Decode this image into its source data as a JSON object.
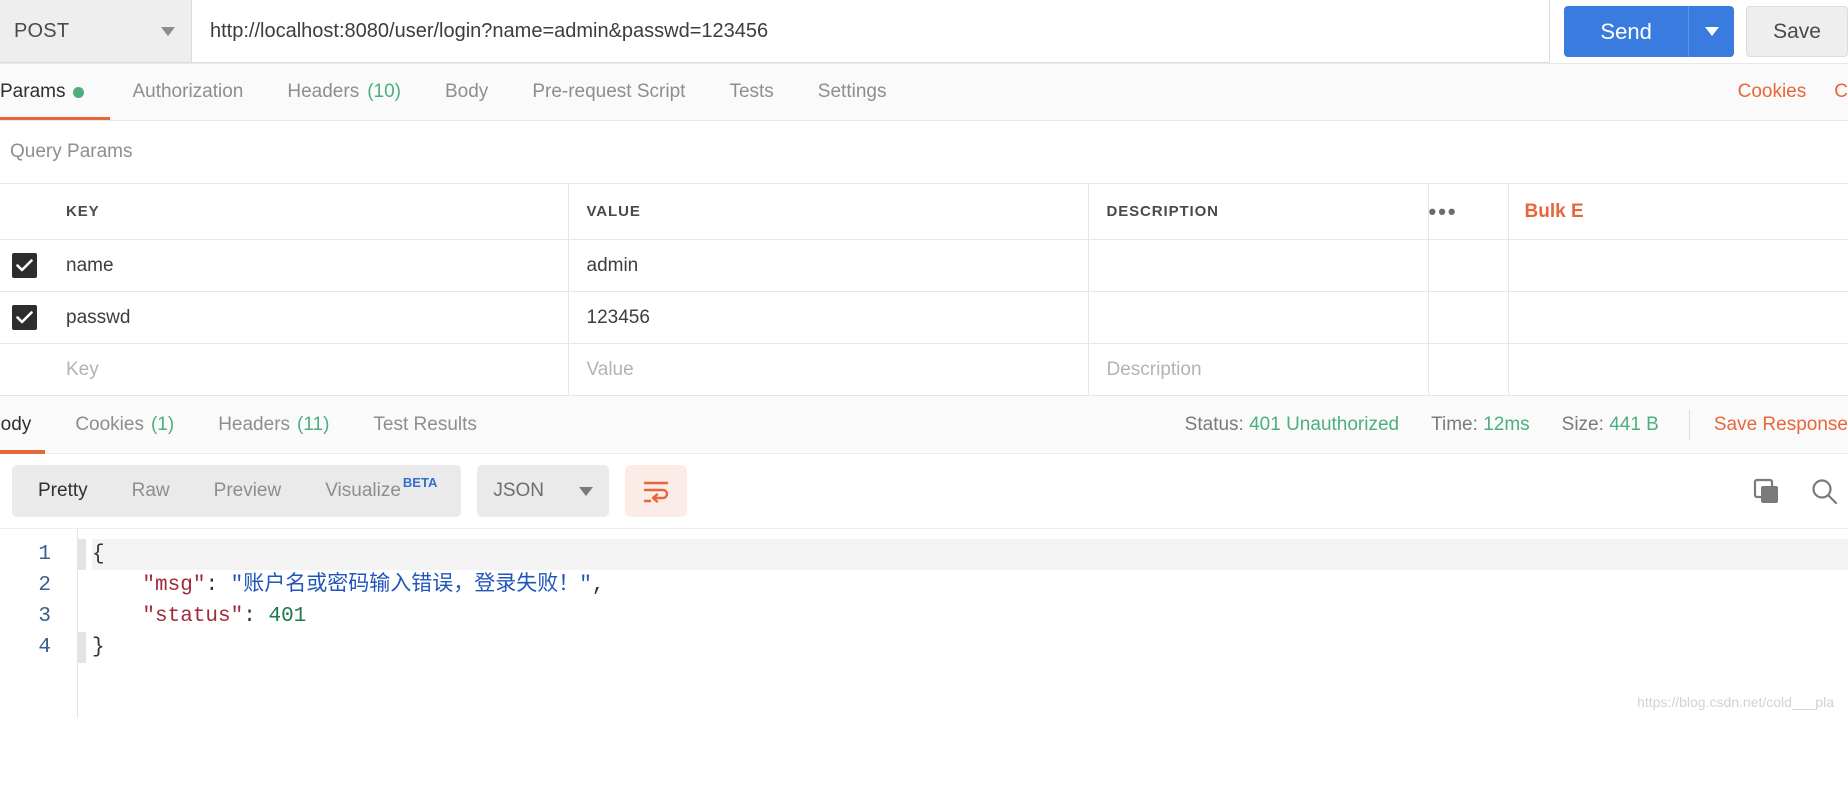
{
  "request_bar": {
    "method": "POST",
    "url": "http://localhost:8080/user/login?name=admin&passwd=123456",
    "send_label": "Send",
    "save_label": "Save"
  },
  "request_tabs": [
    {
      "label": "Params",
      "badge": "",
      "dot": true,
      "active": true
    },
    {
      "label": "Authorization",
      "badge": "",
      "dot": false,
      "active": false
    },
    {
      "label": "Headers",
      "badge": "(10)",
      "dot": false,
      "active": false
    },
    {
      "label": "Body",
      "badge": "",
      "dot": false,
      "active": false
    },
    {
      "label": "Pre-request Script",
      "badge": "",
      "dot": false,
      "active": false
    },
    {
      "label": "Tests",
      "badge": "",
      "dot": false,
      "active": false
    },
    {
      "label": "Settings",
      "badge": "",
      "dot": false,
      "active": false
    }
  ],
  "request_tabs_right": {
    "cookies": "Cookies",
    "code": "C"
  },
  "query_params": {
    "title": "Query Params",
    "columns": [
      "KEY",
      "VALUE",
      "DESCRIPTION"
    ],
    "more_options": "•••",
    "bulk_edit": "Bulk E",
    "rows": [
      {
        "checked": true,
        "key": "name",
        "value": "admin",
        "description": ""
      },
      {
        "checked": true,
        "key": "passwd",
        "value": "123456",
        "description": ""
      }
    ],
    "placeholder_row": {
      "key": "Key",
      "value": "Value",
      "description": "Description"
    }
  },
  "response_status": {
    "status_label": "Status:",
    "status_value": "401 Unauthorized",
    "time_label": "Time:",
    "time_value": "12ms",
    "size_label": "Size:",
    "size_value": "441 B",
    "save_response": "Save Response"
  },
  "response_tabs": [
    {
      "label": "Body",
      "badge": "",
      "active": true
    },
    {
      "label": "Cookies",
      "badge": "(1)",
      "active": false
    },
    {
      "label": "Headers",
      "badge": "(11)",
      "active": false
    },
    {
      "label": "Test Results",
      "badge": "",
      "active": false
    }
  ],
  "format_bar": {
    "segments": [
      "Pretty",
      "Raw",
      "Preview",
      "Visualize"
    ],
    "active_segment": "Pretty",
    "beta_badge": "BETA",
    "language": "JSON"
  },
  "code_body": {
    "line_numbers": [
      "1",
      "2",
      "3",
      "4"
    ],
    "lines": [
      {
        "indent": "",
        "tokens": [
          {
            "t": "brace",
            "v": "{"
          }
        ]
      },
      {
        "indent": "    ",
        "tokens": [
          {
            "t": "key",
            "v": "\"msg\""
          },
          {
            "t": "punct",
            "v": ": "
          },
          {
            "t": "str",
            "v": "\"账户名或密码输入错误，登录失败！\""
          },
          {
            "t": "punct",
            "v": ","
          }
        ]
      },
      {
        "indent": "    ",
        "tokens": [
          {
            "t": "key",
            "v": "\"status\""
          },
          {
            "t": "punct",
            "v": ": "
          },
          {
            "t": "num",
            "v": "401"
          }
        ]
      },
      {
        "indent": "",
        "tokens": [
          {
            "t": "brace",
            "v": "}"
          }
        ]
      }
    ]
  },
  "watermark": "https://blog.csdn.net/cold___pla",
  "colors": {
    "accent_orange": "#e8663b",
    "send_blue": "#3a7be0",
    "status_green": "#4caf7d",
    "beta_blue": "#2f6fd0"
  }
}
